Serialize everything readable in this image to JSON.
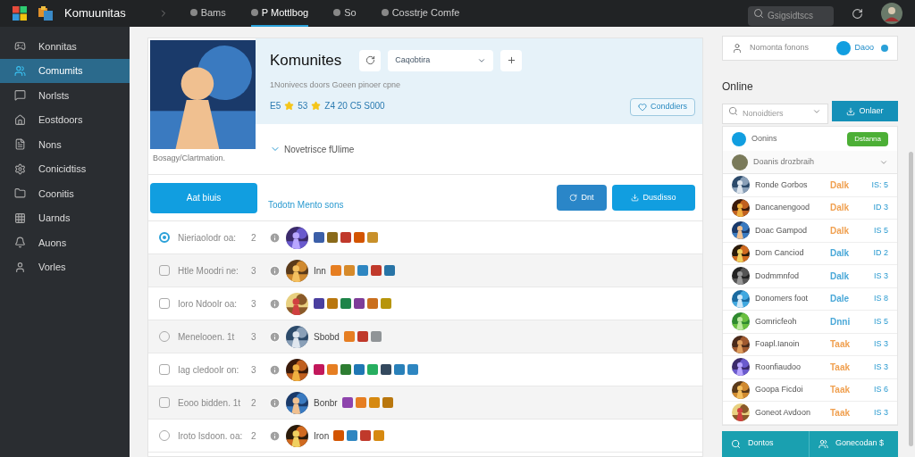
{
  "topbar": {
    "app_title": "Komuunitas",
    "nav": [
      {
        "label": "Bams",
        "selected": false
      },
      {
        "label": "P Mottlbog",
        "selected": true
      },
      {
        "label": "So",
        "selected": false
      },
      {
        "label": "Cosstrje Comfe",
        "selected": false
      }
    ],
    "search_placeholder": "Gsigsidtscs"
  },
  "sidebar": {
    "items": [
      {
        "label": "Konnitas",
        "selected": false
      },
      {
        "label": "Comumits",
        "selected": true
      },
      {
        "label": "Norlsts",
        "selected": false
      },
      {
        "label": "Eostdoors",
        "selected": false
      },
      {
        "label": "Nons",
        "selected": false
      },
      {
        "label": "Conicidtiss",
        "selected": false
      },
      {
        "label": "Coonitis",
        "selected": false
      },
      {
        "label": "Uarnds",
        "selected": false
      },
      {
        "label": "Auons",
        "selected": false
      },
      {
        "label": "Vorles",
        "selected": false
      }
    ]
  },
  "header": {
    "title": "Komunites",
    "dropdown": "Caqobtira",
    "description": "1Nonivecs doors Goeen pinoer cpne",
    "stats": [
      {
        "kind": "text",
        "text": "E5"
      },
      {
        "kind": "star"
      },
      {
        "kind": "text",
        "text": "53"
      },
      {
        "kind": "star"
      },
      {
        "kind": "text",
        "text": "Z4 20 C5 S000"
      }
    ],
    "image_caption": "Bosagy/Clartmation.",
    "follow_link": "Novetrisce fUlime",
    "action_button": "Conddiers"
  },
  "toolbar": {
    "primary_button": "Aat biuis",
    "link": "Todotn Mento sons",
    "buttons": [
      "Dnt",
      "Dusdisso"
    ]
  },
  "rows": [
    {
      "kind": "radio",
      "selected": true,
      "name": "Nieriaolodr oa:",
      "count": "2",
      "lead": "",
      "icons": [
        {
          "color": "#3b5fa8"
        },
        {
          "color": "#8a6a1a"
        },
        {
          "color": "#c0392b"
        },
        {
          "color": "#d35400"
        },
        {
          "color": "#c8902a"
        }
      ]
    },
    {
      "kind": "checkbox",
      "selected": false,
      "name": "Htle Moodri ne:",
      "count": "3",
      "lead": "Inn",
      "icons": [
        {
          "color": "#e67e22"
        },
        {
          "color": "#d68a2a"
        },
        {
          "color": "#2e86c1"
        },
        {
          "color": "#c0392b"
        },
        {
          "color": "#2874a6"
        }
      ]
    },
    {
      "kind": "checkbox",
      "selected": false,
      "name": "Ioro Ndoolr oa:",
      "count": "3",
      "lead": "",
      "icons": [
        {
          "color": "#4a3f9f"
        },
        {
          "color": "#b9770e"
        },
        {
          "color": "#1e8449"
        },
        {
          "color": "#7d3c98"
        },
        {
          "color": "#ca6f1e"
        },
        {
          "color": "#b7950b"
        }
      ]
    },
    {
      "kind": "radio",
      "selected": false,
      "name": "Menelooen. 1t",
      "count": "3",
      "lead": "Sbobd",
      "icons": [
        {
          "color": "#e67e22"
        },
        {
          "color": "#c0392b"
        },
        {
          "color": "#909497"
        }
      ]
    },
    {
      "kind": "checkbox",
      "selected": false,
      "name": "Iag cledoolr on:",
      "count": "3",
      "lead": "",
      "icons": [
        {
          "color": "#c2185b"
        },
        {
          "color": "#e67e22"
        },
        {
          "color": "#2e7d32"
        },
        {
          "color": "#1f77b4"
        },
        {
          "color": "#27ae60"
        },
        {
          "color": "#34495e"
        },
        {
          "color": "#2980b9"
        },
        {
          "color": "#2e86c1"
        }
      ]
    },
    {
      "kind": "checkbox",
      "selected": false,
      "name": "Eooo bidden. 1t",
      "count": "2",
      "lead": "Bonbr",
      "icons": [
        {
          "color": "#8e44ad"
        },
        {
          "color": "#e67e22"
        },
        {
          "color": "#d68910"
        },
        {
          "color": "#b9770e"
        }
      ]
    },
    {
      "kind": "radio",
      "selected": false,
      "name": "Iroto Isdoon. oa:",
      "count": "2",
      "lead": "Iron",
      "icons": [
        {
          "color": "#d35400"
        },
        {
          "color": "#2e86c1"
        },
        {
          "color": "#c0392b"
        },
        {
          "color": "#d68910"
        }
      ]
    }
  ],
  "right": {
    "top_card": {
      "label": "Nomonta fonons",
      "button": "Daoo"
    },
    "heading": "Online",
    "search_placeholder": "Nonoidtiers",
    "search_button": "Onlaer",
    "group": {
      "label": "Oonins",
      "badge": "Dstanna"
    },
    "subgroup": {
      "label": "Doanis drozbraih",
      "expanded": false
    },
    "members": [
      {
        "name": "Ronde Gorbos",
        "status": "Dalk",
        "color": "#f0a050",
        "id": "IS: 5"
      },
      {
        "name": "Dancanengood",
        "status": "Dalk",
        "color": "#f0a050",
        "id": "ID 3"
      },
      {
        "name": "Doac Gampod",
        "status": "Dalk",
        "color": "#f0a050",
        "id": "IS 5"
      },
      {
        "name": "Dom Canciod",
        "status": "Dalk",
        "color": "#4aa8d8",
        "id": "ID 2"
      },
      {
        "name": "Dodmmnfod",
        "status": "Dalk",
        "color": "#4aa8d8",
        "id": "IS 3"
      },
      {
        "name": "Donomers foot",
        "status": "Dale",
        "color": "#4aa8d8",
        "id": "IS 8"
      },
      {
        "name": "Gomricfeoh",
        "status": "Dnni",
        "color": "#4aa8d8",
        "id": "IS 5"
      },
      {
        "name": "Foapl.Ianoin",
        "status": "Taak",
        "color": "#f0a050",
        "id": "IS 3"
      },
      {
        "name": "Roonfiaudoo",
        "status": "Taak",
        "color": "#f0a050",
        "id": "IS 3"
      },
      {
        "name": "Goopa Ficdoi",
        "status": "Taak",
        "color": "#f0a050",
        "id": "IS 6"
      },
      {
        "name": "Goneot Avdoon",
        "status": "Taak",
        "color": "#f0a050",
        "id": "IS 3"
      }
    ],
    "bottom_buttons": [
      "Dontos",
      "Gonecodan $"
    ]
  }
}
